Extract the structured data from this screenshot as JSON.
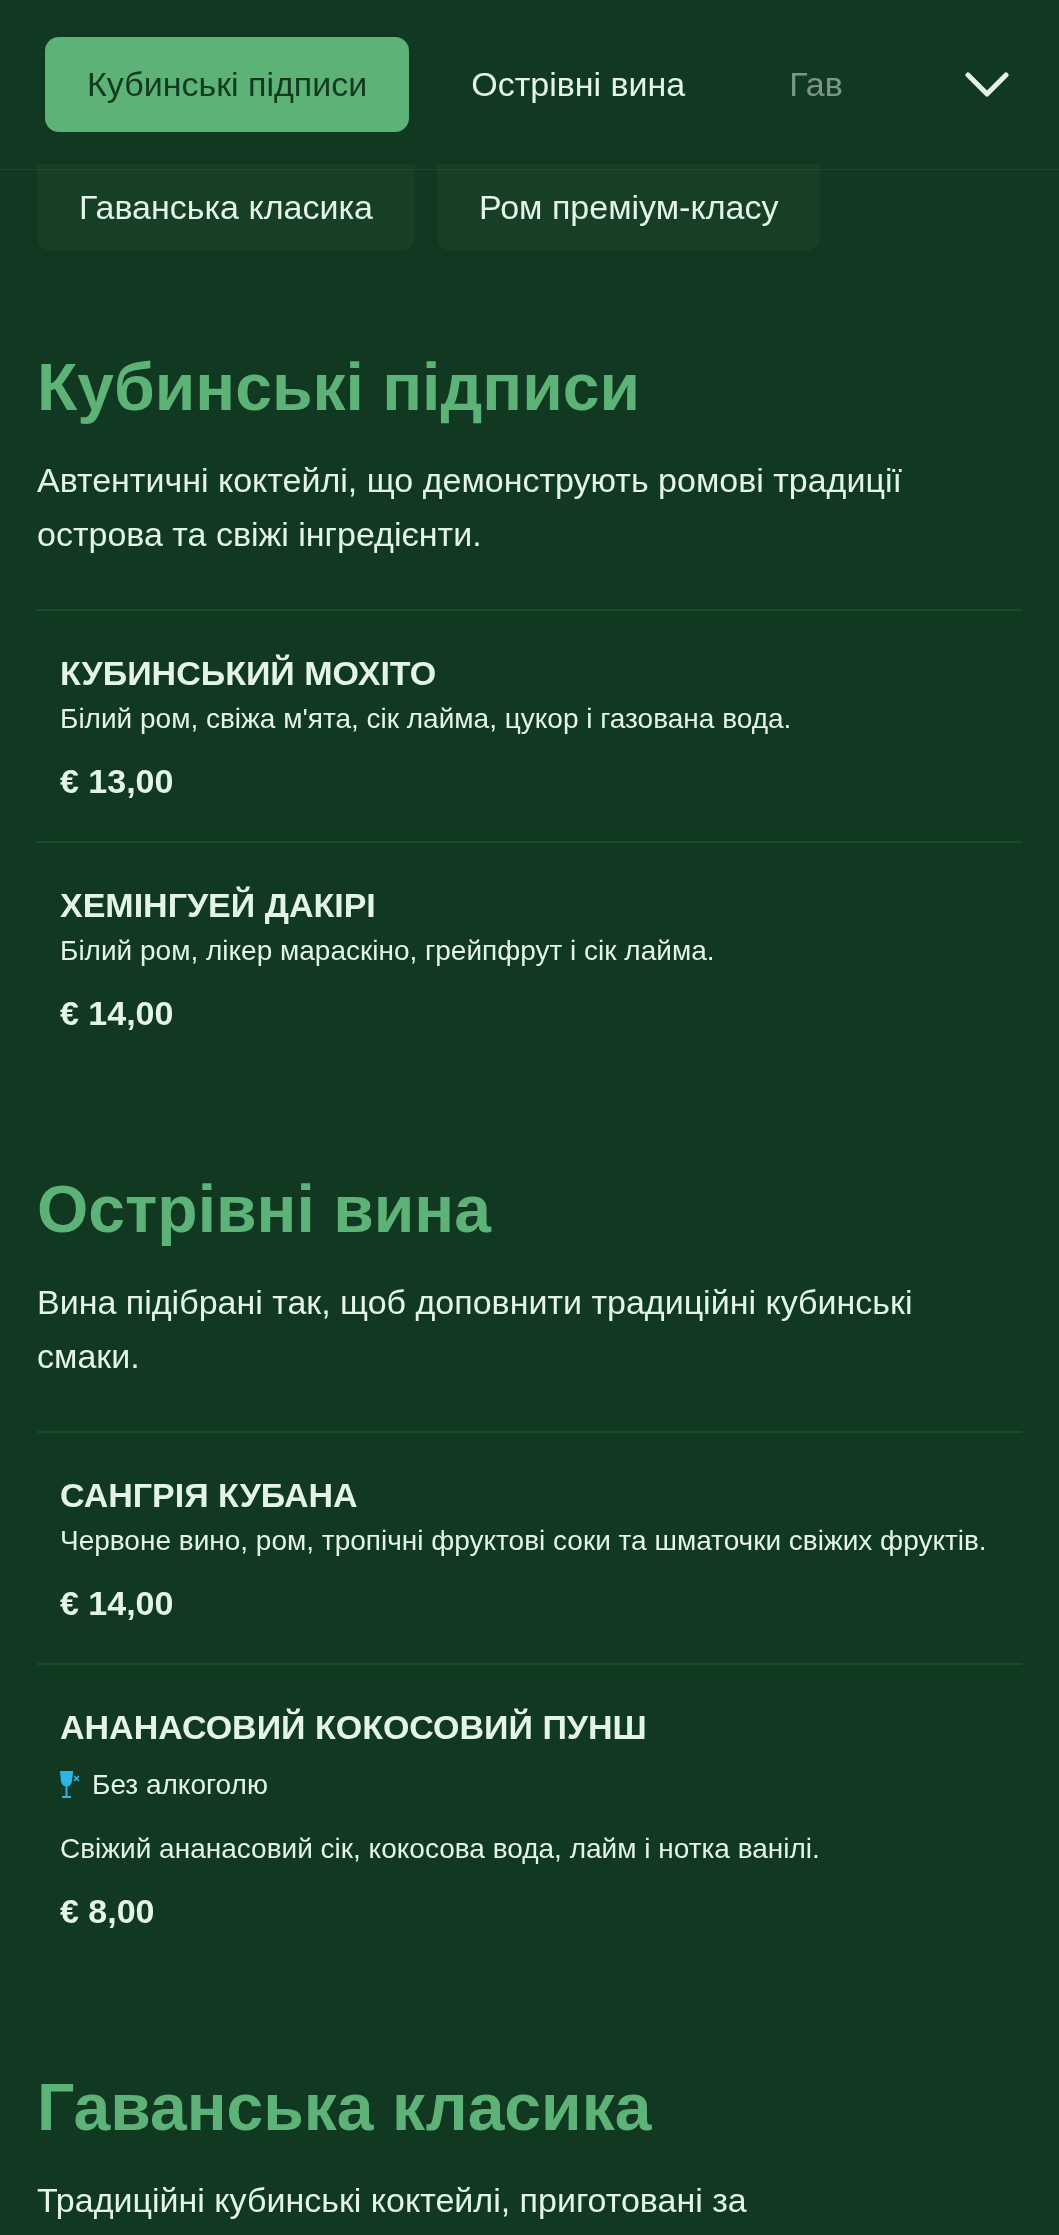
{
  "nav": {
    "tabs": [
      {
        "label": "Кубинські підписи",
        "selected": true
      },
      {
        "label": "Острівні вина",
        "selected": false
      },
      {
        "label": "Гав",
        "selected": false
      }
    ],
    "expanded": true,
    "overflow_tabs": [
      {
        "label": "Гаванська класика",
        "selected": false
      },
      {
        "label": "Ром преміум-класу",
        "selected": false
      }
    ]
  },
  "sections": [
    {
      "title": "Кубинські підписи",
      "description": "Автентичні коктейлі, що демонструють ромові традиції острова та свіжі інгредієнти.",
      "items": [
        {
          "name": "КУБИНСЬКИЙ МОХІТО",
          "description": "Білий ром, свіжа м'ята, сік лайма, цукор і газована вода.",
          "price": "€ 13,00"
        },
        {
          "name": "ХЕМІНГУЕЙ ДАКІРІ",
          "description": "Білий ром, лікер мараскіно, грейпфрут і сік лайма.",
          "price": "€ 14,00"
        }
      ]
    },
    {
      "title": "Острівні вина",
      "description": "Вина підібрані так, щоб доповнити традиційні кубинські смаки.",
      "items": [
        {
          "name": "САНГРІЯ КУБАНА",
          "description": "Червоне вино, ром, тропічні фруктові соки та шматочки свіжих фруктів.",
          "price": "€ 14,00"
        },
        {
          "name": "АНАНАСОВИЙ КОКОСОВИЙ ПУНШ",
          "badge": "Без алкоголю",
          "description": "Свіжий ананасовий сік, кокосова вода, лайм і нотка ванілі.",
          "price": "€ 8,00"
        }
      ]
    },
    {
      "title": "Гаванська класика",
      "description": "Традиційні кубинські коктейлі, приготовані за"
    }
  ]
}
